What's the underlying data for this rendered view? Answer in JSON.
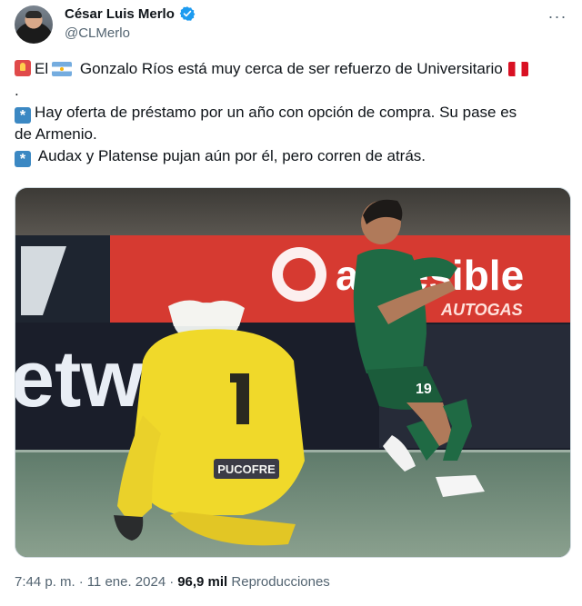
{
  "author": {
    "display_name": "César Luis Merlo",
    "handle": "@CLMerlo",
    "verified_color": "#1d9bf0"
  },
  "tweet": {
    "line1_a": "El",
    "line1_b": "Gonzalo Ríos está muy cerca de ser refuerzo de Universitario",
    "line2": ".",
    "line3": "Hay oferta de préstamo por un año con opción de compra. Su pase es",
    "line4": "de Armenio.",
    "line5": "Audax y Platense pujan aún por él, pero corren de atrás."
  },
  "media": {
    "banner_text": "accesible",
    "banner_subtext": "AUTOGAS",
    "banner_left_text": "etw",
    "keeper_shirt_text": "PUCOFRE",
    "keeper_number": "1",
    "player_number": "19"
  },
  "meta": {
    "time": "7:44 p. m.",
    "date": "11 ene. 2024",
    "views_count": "96,9 mil",
    "views_label": "Reproducciones"
  },
  "icons": [
    "verified-badge-icon",
    "more-options-icon",
    "police-light-emoji",
    "argentina-flag-emoji",
    "peru-flag-emoji",
    "asterisk-emoji"
  ]
}
